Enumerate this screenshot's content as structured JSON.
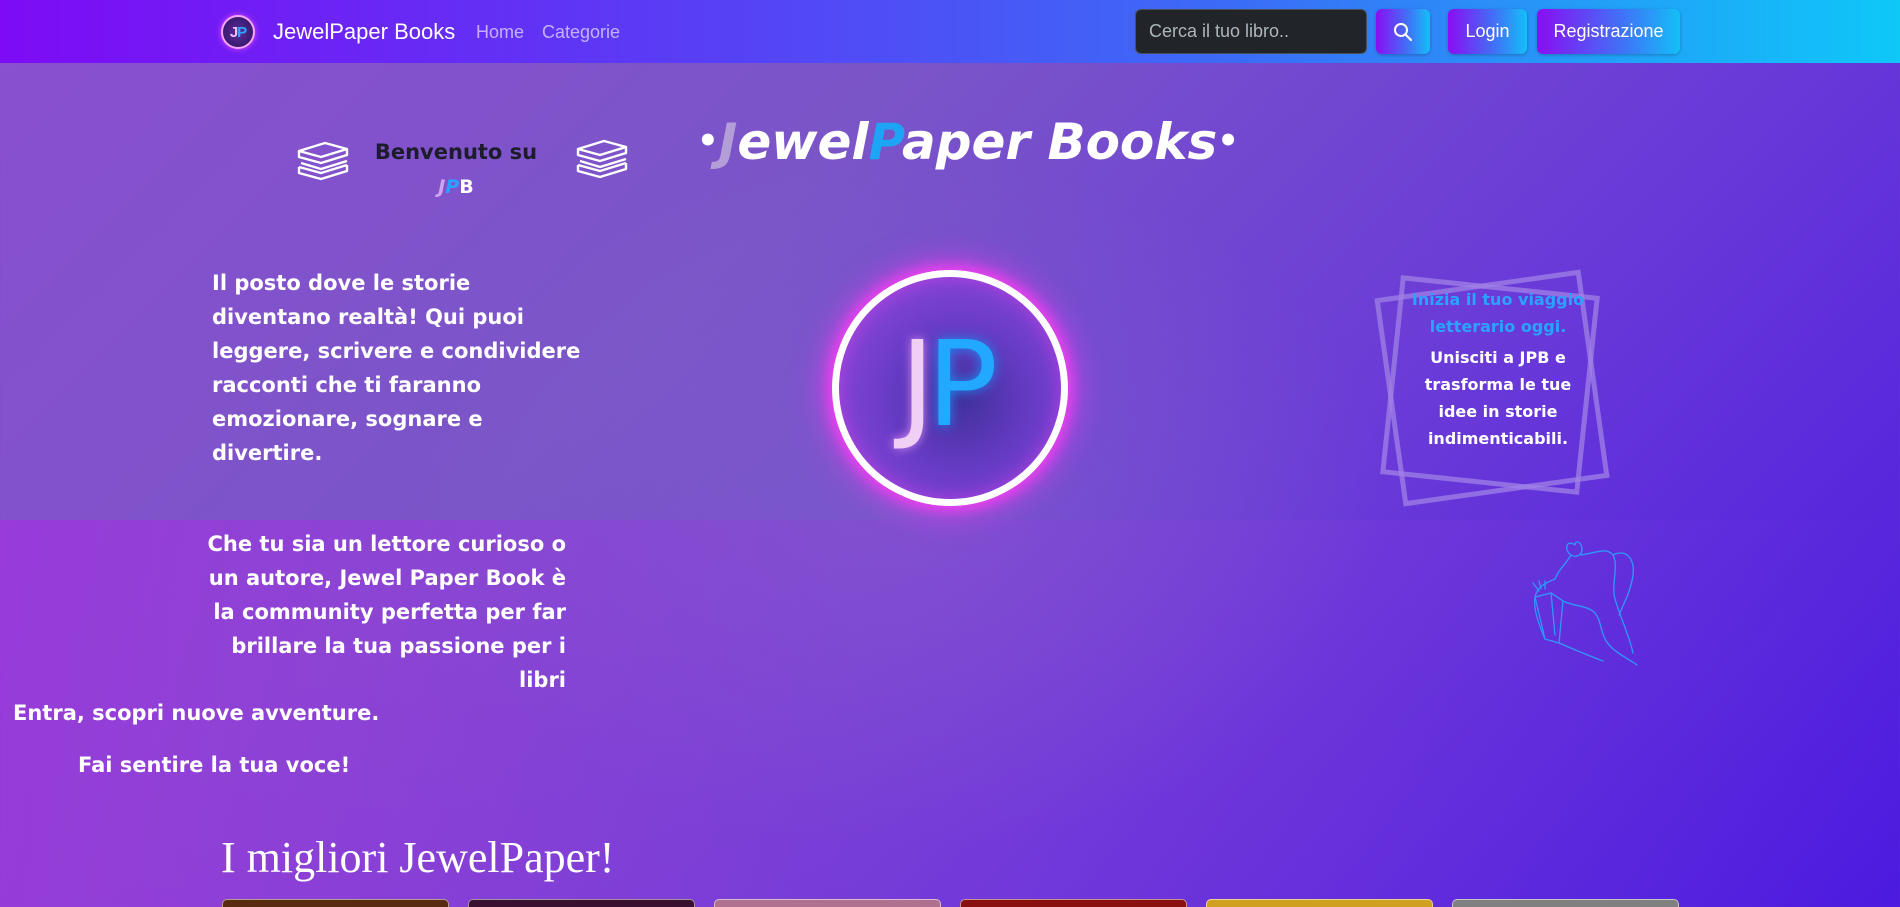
{
  "navbar": {
    "logo_j": "J",
    "logo_p": "P",
    "brand": "JewelPaper Books",
    "links": [
      "Home",
      "Categorie"
    ],
    "search_placeholder": "Cerca il tuo libro..",
    "login": "Login",
    "register": "Registrazione"
  },
  "hero": {
    "welcome_line1": "Benvenuto su",
    "welcome_j": "J",
    "welcome_p": "P",
    "welcome_b": "B",
    "title_dot_left": "•",
    "title_j": "J",
    "title_ewel": "ewel",
    "title_p": "P",
    "title_aper": "aper Books",
    "title_dot_right": "•",
    "logo_j": "J",
    "logo_p": "P",
    "paragraph1": "Il posto dove le storie diventano realtà! Qui puoi leggere, scrivere e condividere racconti che ti faranno emozionare, sognare e divertire.",
    "paragraph2": "Che tu sia un lettore curioso o un autore, Jewel Paper Book è la community perfetta per far brillare la tua passione per i libri",
    "line3": "Entra, scopri nuove avventure.",
    "line4": "Fai sentire la tua voce!",
    "callout_heading": "Inizia il tuo viaggio letterario oggi.",
    "callout_body": "Unisciti a JPB e trasforma le tue idee in storie indimenticabili."
  },
  "best": {
    "title": "I migliori JewelPaper!",
    "thumb_colors": [
      "#5a2a10",
      "#3a1030",
      "#b07090",
      "#8a1010",
      "#d0a020",
      "#808080"
    ]
  },
  "colors": {
    "accent_blue": "#1ea4f4",
    "accent_pink": "#f03ff0"
  }
}
